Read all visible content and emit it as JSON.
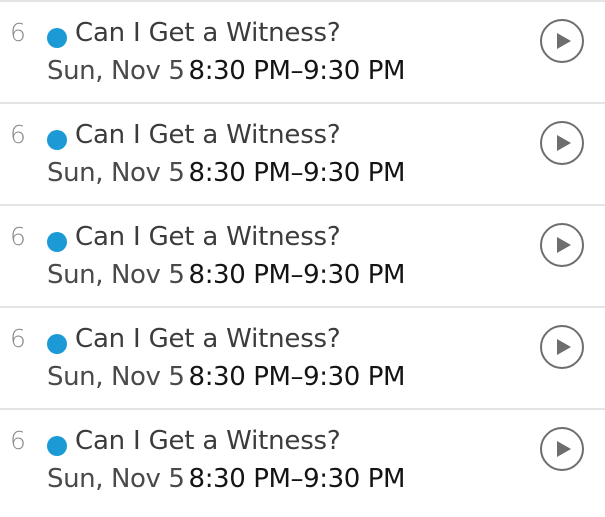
{
  "colors": {
    "accent_dot": "#1c9ad6",
    "divider": "#e4e4e4"
  },
  "episodes": [
    {
      "number": "6",
      "title": "Can I Get a Witness?",
      "date": "Sun, Nov 5",
      "time": "8:30 PM–9:30 PM",
      "action_icon": "play-circle-icon"
    },
    {
      "number": "6",
      "title": "Can I Get a Witness?",
      "date": "Sun, Nov 5",
      "time": "8:30 PM–9:30 PM",
      "action_icon": "play-circle-icon"
    },
    {
      "number": "6",
      "title": "Can I Get a Witness?",
      "date": "Sun, Nov 5",
      "time": "8:30 PM–9:30 PM",
      "action_icon": "play-circle-icon"
    },
    {
      "number": "6",
      "title": "Can I Get a Witness?",
      "date": "Sun, Nov 5",
      "time": "8:30 PM–9:30 PM",
      "action_icon": "play-circle-icon"
    },
    {
      "number": "6",
      "title": "Can I Get a Witness?",
      "date": "Sun, Nov 5",
      "time": "8:30 PM–9:30 PM",
      "action_icon": "play-circle-icon"
    }
  ]
}
